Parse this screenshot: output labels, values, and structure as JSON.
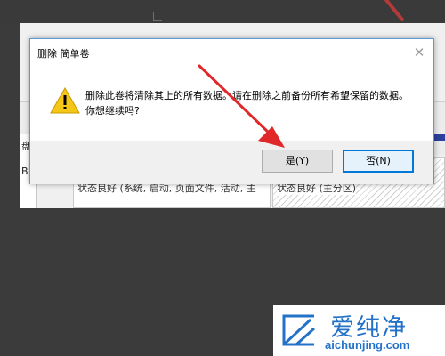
{
  "background": {
    "left_chars": [
      "盘",
      "B"
    ]
  },
  "underlying": {
    "panel_a_status": "状态良好 (系统, 启动, 页面文件, 活动, 主",
    "panel_b_status": "状态良好 (主分区)"
  },
  "dialog": {
    "title": "删除 简单卷",
    "close_glyph": "✕",
    "message": "删除此卷将清除其上的所有数据。请在删除之前备份所有希望保留的数据。你想继续吗?",
    "buttons": {
      "yes": "是(Y)",
      "no": "否(N)"
    }
  },
  "watermark": {
    "title": "爱纯净",
    "url": "aichunjing.com"
  },
  "colors": {
    "accent": "#0078d7",
    "arrow": "#e0282b",
    "logo": "#2472c8",
    "warning": "#f5c518"
  }
}
